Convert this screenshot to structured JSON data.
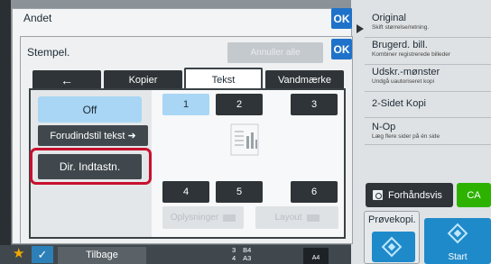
{
  "right_panel": {
    "items": [
      {
        "title": "Original",
        "subtitle": "Skift størrelse/retning."
      },
      {
        "title": "Brugerd. bill.",
        "subtitle": "Kombiner registrerede billeder"
      },
      {
        "title": "Udskr.-mønster",
        "subtitle": "Undgå uautoriseret kopi"
      },
      {
        "title": "2-Sidet Kopi",
        "subtitle": ""
      },
      {
        "title": "N-Op",
        "subtitle": "Læg flere sider på én side"
      }
    ],
    "preview_label": "Forhåndsvis",
    "ca_label": "CA",
    "proof_label": "Prøvekopi.",
    "start_label": "Start"
  },
  "bottom_bar": {
    "back_label": "Tilbage",
    "tray_rows": [
      {
        "num": "3",
        "size": "B4"
      },
      {
        "num": "4",
        "size": "A3"
      }
    ],
    "tray_size": "A4"
  },
  "andet": {
    "title": "Andet",
    "ok_label": "OK"
  },
  "stempel": {
    "title": "Stempel.",
    "cancel_all_label": "Annuller alle",
    "ok_label": "OK",
    "tabs": [
      "Kopier",
      "Tekst",
      "Vandmærke"
    ],
    "active_tab": "Tekst",
    "off_label": "Off",
    "preset_label": "Forudindstil tekst",
    "direct_label": "Dir. Indtastn.",
    "positions": [
      "1",
      "2",
      "3",
      "4",
      "5",
      "6"
    ],
    "selected_position": "1",
    "info_label": "Oplysninger",
    "layout_label": "Layout"
  },
  "colors": {
    "accent_blue": "#1f72c9",
    "selected": "#a8d6f4",
    "highlight": "#c8102e",
    "ca_green": "#2db200",
    "star": "#f2a900"
  }
}
